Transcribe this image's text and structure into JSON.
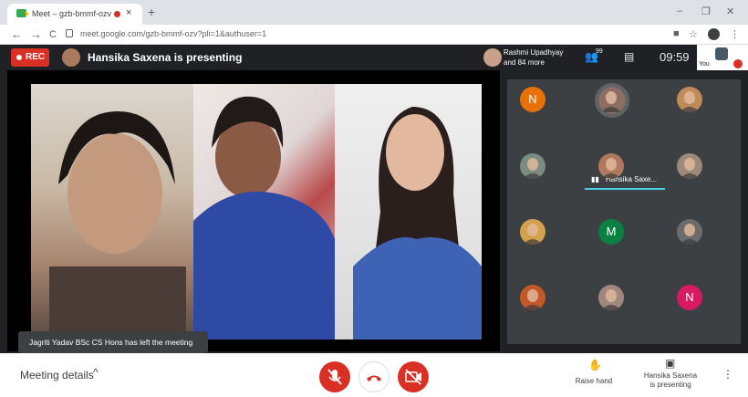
{
  "browser": {
    "tab_title": "Meet – gzb-bmmf-ozv",
    "tab_close": "×",
    "new_tab": "+",
    "minimize": "–",
    "restore": "❐",
    "close": "✕",
    "url": "meet.google.com/gzb-bmmf-ozv?pli=1&authuser=1",
    "back": "←",
    "forward": "→",
    "reload": "C",
    "star": "☆",
    "menu": "⋮",
    "extension": "■"
  },
  "meet_top": {
    "rec_label": "REC",
    "presenting_text": "Hansika Saxena is presenting",
    "participants_name": "Rashmi Upadhyay",
    "participants_more": "and 84 more",
    "participants_count": "99",
    "time": "09:59",
    "you_label": "You"
  },
  "toast": "Jagriti Yadav BSc CS Hons has left the meeting",
  "grid": {
    "tiles": [
      {
        "type": "letter",
        "letter": "N",
        "color": "#e8710a"
      },
      {
        "type": "photo",
        "color": "#8d6e63",
        "speaking": true,
        "label": "Hansika Saxe..."
      },
      {
        "type": "photo",
        "color": "#c08a5b"
      },
      {
        "type": "photo",
        "color": "#7a8b7f"
      },
      {
        "type": "photo",
        "color": "#b0785f"
      },
      {
        "type": "photo",
        "color": "#9e8a7a"
      },
      {
        "type": "photo",
        "color": "#d4a24c"
      },
      {
        "type": "letter",
        "letter": "M",
        "color": "#0b8043"
      },
      {
        "type": "photo",
        "color": "#6b6b6b"
      },
      {
        "type": "photo",
        "color": "#c2582a"
      },
      {
        "type": "photo",
        "color": "#a1887f"
      },
      {
        "type": "letter",
        "letter": "N",
        "color": "#d81b60"
      }
    ]
  },
  "bottom": {
    "meeting_details": "Meeting details",
    "chevron": "^",
    "raise_hand": "Raise hand",
    "presenting_line1": "Hansika Saxena",
    "presenting_line2": "is presenting",
    "more": "⋮"
  },
  "colors": {
    "accent_red": "#d93025",
    "speaking_bar": "#4ecde6",
    "meet_bg": "#202124",
    "tile_bg": "#3c4043"
  }
}
